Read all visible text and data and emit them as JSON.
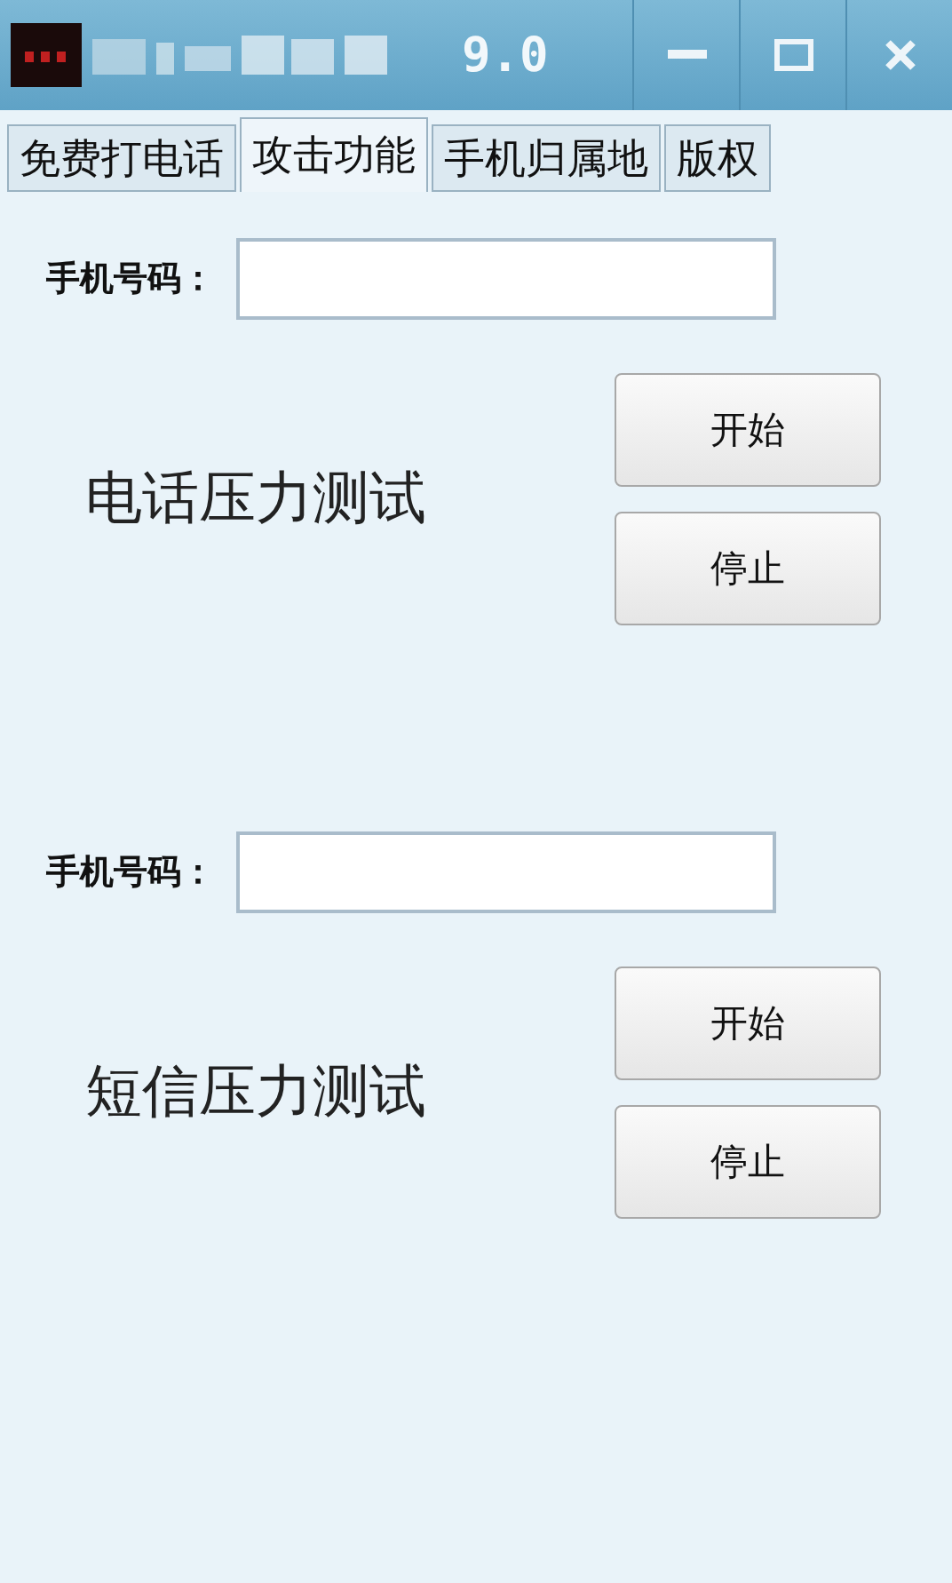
{
  "window": {
    "title": "9.0"
  },
  "tabs": [
    {
      "label": "免费打电话",
      "selected": false
    },
    {
      "label": "攻击功能",
      "selected": true
    },
    {
      "label": "手机归属地",
      "selected": false
    },
    {
      "label": "版权",
      "selected": false
    }
  ],
  "sections": [
    {
      "field_label": "手机号码：",
      "title": "电话压力测试",
      "buttons": [
        "开始",
        "停止"
      ]
    },
    {
      "field_label": "手机号码：",
      "title": "短信压力测试",
      "buttons": [
        "开始",
        "停止"
      ]
    }
  ]
}
